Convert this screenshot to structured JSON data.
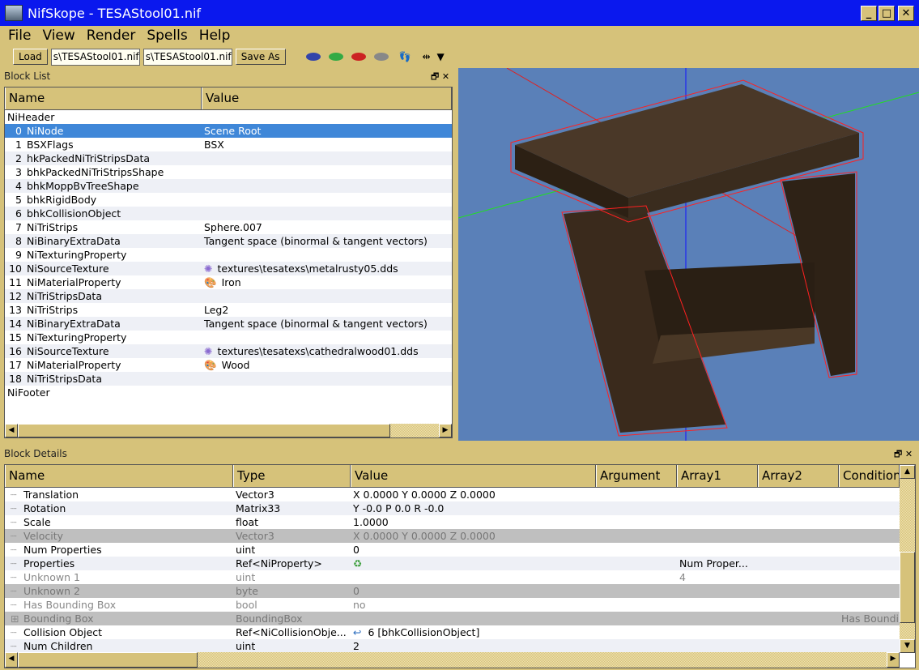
{
  "window": {
    "title": "NifSkope - TESAStool01.nif"
  },
  "menu": [
    "File",
    "View",
    "Render",
    "Spells",
    "Help"
  ],
  "toolbar": {
    "load": "Load",
    "load_path": "s\\TESAStool01.nif",
    "save_path": "s\\TESAStool01.nif",
    "save_as": "Save As"
  },
  "block_list": {
    "title": "Block List",
    "columns": [
      "Name",
      "Value"
    ],
    "rows": [
      {
        "name": "NiHeader",
        "value": ""
      },
      {
        "index": "0",
        "name": "NiNode",
        "value": "Scene Root",
        "selected": true
      },
      {
        "index": "1",
        "name": "BSXFlags",
        "value": "BSX"
      },
      {
        "index": "2",
        "name": "hkPackedNiTriStripsData",
        "value": ""
      },
      {
        "index": "3",
        "name": "bhkPackedNiTriStripsShape",
        "value": ""
      },
      {
        "index": "4",
        "name": "bhkMoppBvTreeShape",
        "value": ""
      },
      {
        "index": "5",
        "name": "bhkRigidBody",
        "value": ""
      },
      {
        "index": "6",
        "name": "bhkCollisionObject",
        "value": ""
      },
      {
        "index": "7",
        "name": "NiTriStrips",
        "value": "Sphere.007"
      },
      {
        "index": "8",
        "name": "NiBinaryExtraData",
        "value": "Tangent space (binormal & tangent vectors)"
      },
      {
        "index": "9",
        "name": "NiTexturingProperty",
        "value": ""
      },
      {
        "index": "10",
        "name": "NiSourceTexture",
        "value": "textures\\tesatexs\\metalrusty05.dds",
        "icon": "texture-icon"
      },
      {
        "index": "11",
        "name": "NiMaterialProperty",
        "value": "Iron",
        "icon": "palette-icon"
      },
      {
        "index": "12",
        "name": "NiTriStripsData",
        "value": ""
      },
      {
        "index": "13",
        "name": "NiTriStrips",
        "value": "Leg2"
      },
      {
        "index": "14",
        "name": "NiBinaryExtraData",
        "value": "Tangent space (binormal & tangent vectors)"
      },
      {
        "index": "15",
        "name": "NiTexturingProperty",
        "value": ""
      },
      {
        "index": "16",
        "name": "NiSourceTexture",
        "value": "textures\\tesatexs\\cathedralwood01.dds",
        "icon": "texture-icon"
      },
      {
        "index": "17",
        "name": "NiMaterialProperty",
        "value": "Wood",
        "icon": "palette-icon"
      },
      {
        "index": "18",
        "name": "NiTriStripsData",
        "value": ""
      },
      {
        "name": "NiFooter",
        "value": ""
      }
    ]
  },
  "block_details": {
    "title": "Block Details",
    "columns": [
      "Name",
      "Type",
      "Value",
      "Argument",
      "Array1",
      "Array2",
      "Condition"
    ],
    "rows": [
      {
        "name": "Translation",
        "type": "Vector3",
        "value": "X 0.0000 Y 0.0000 Z 0.0000"
      },
      {
        "name": "Rotation",
        "type": "Matrix33",
        "value": "Y -0.0 P 0.0 R -0.0"
      },
      {
        "name": "Scale",
        "type": "float",
        "value": "1.0000"
      },
      {
        "name": "Velocity",
        "type": "Vector3",
        "value": "X 0.0000 Y 0.0000 Z 0.0000",
        "state": "disabled"
      },
      {
        "name": "Num Properties",
        "type": "uint",
        "value": "0"
      },
      {
        "name": "Properties",
        "type": "Ref<NiProperty>",
        "value": "",
        "icon": "link-icon",
        "array1": "Num Proper..."
      },
      {
        "name": "Unknown 1",
        "type": "uint",
        "value": "",
        "array1": "4",
        "state": "grey"
      },
      {
        "name": "Unknown 2",
        "type": "byte",
        "value": "0",
        "state": "disabled"
      },
      {
        "name": "Has Bounding Box",
        "type": "bool",
        "value": "no",
        "state": "grey"
      },
      {
        "name": "Bounding Box",
        "type": "BoundingBox",
        "value": "",
        "condition": "Has Boundi",
        "state": "disabled",
        "expandable": true
      },
      {
        "name": "Collision Object",
        "type": "Ref<NiCollisionObje...",
        "value": "6 [bhkCollisionObject]",
        "icon": "reference-icon"
      },
      {
        "name": "Num Children",
        "type": "uint",
        "value": "2"
      }
    ]
  },
  "colors": {
    "titlebar": "#0a18ee",
    "chrome": "#d6c27a",
    "selection": "#3f87d8",
    "viewport": "#5a80b8"
  }
}
